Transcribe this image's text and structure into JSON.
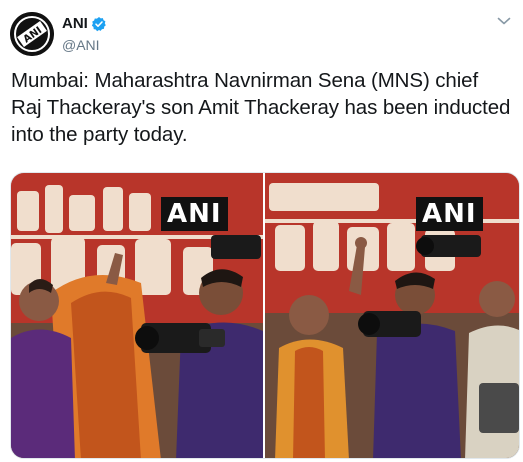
{
  "account": {
    "display_name": "ANI",
    "handle": "@ANI",
    "avatar_text": "ANI",
    "verified": true
  },
  "icons": {
    "avatar": "ani-logo-avatar",
    "verified": "verified-badge-icon",
    "menu": "chevron-down-icon"
  },
  "tweet": {
    "lines": [
      "Mumbai: Maharashtra Navnirman Sena (MNS) chief",
      "Raj Thackeray's son Amit Thackeray has been inducted",
      "into the party today."
    ]
  },
  "media": {
    "watermark_left": "ANI",
    "watermark_right": "ANI"
  },
  "colors": {
    "text": "#14171a",
    "secondary": "#657786",
    "verified_blue": "#1da1f2",
    "banner_red": "#b8352a",
    "banner_cream": "#f3e8d6"
  }
}
